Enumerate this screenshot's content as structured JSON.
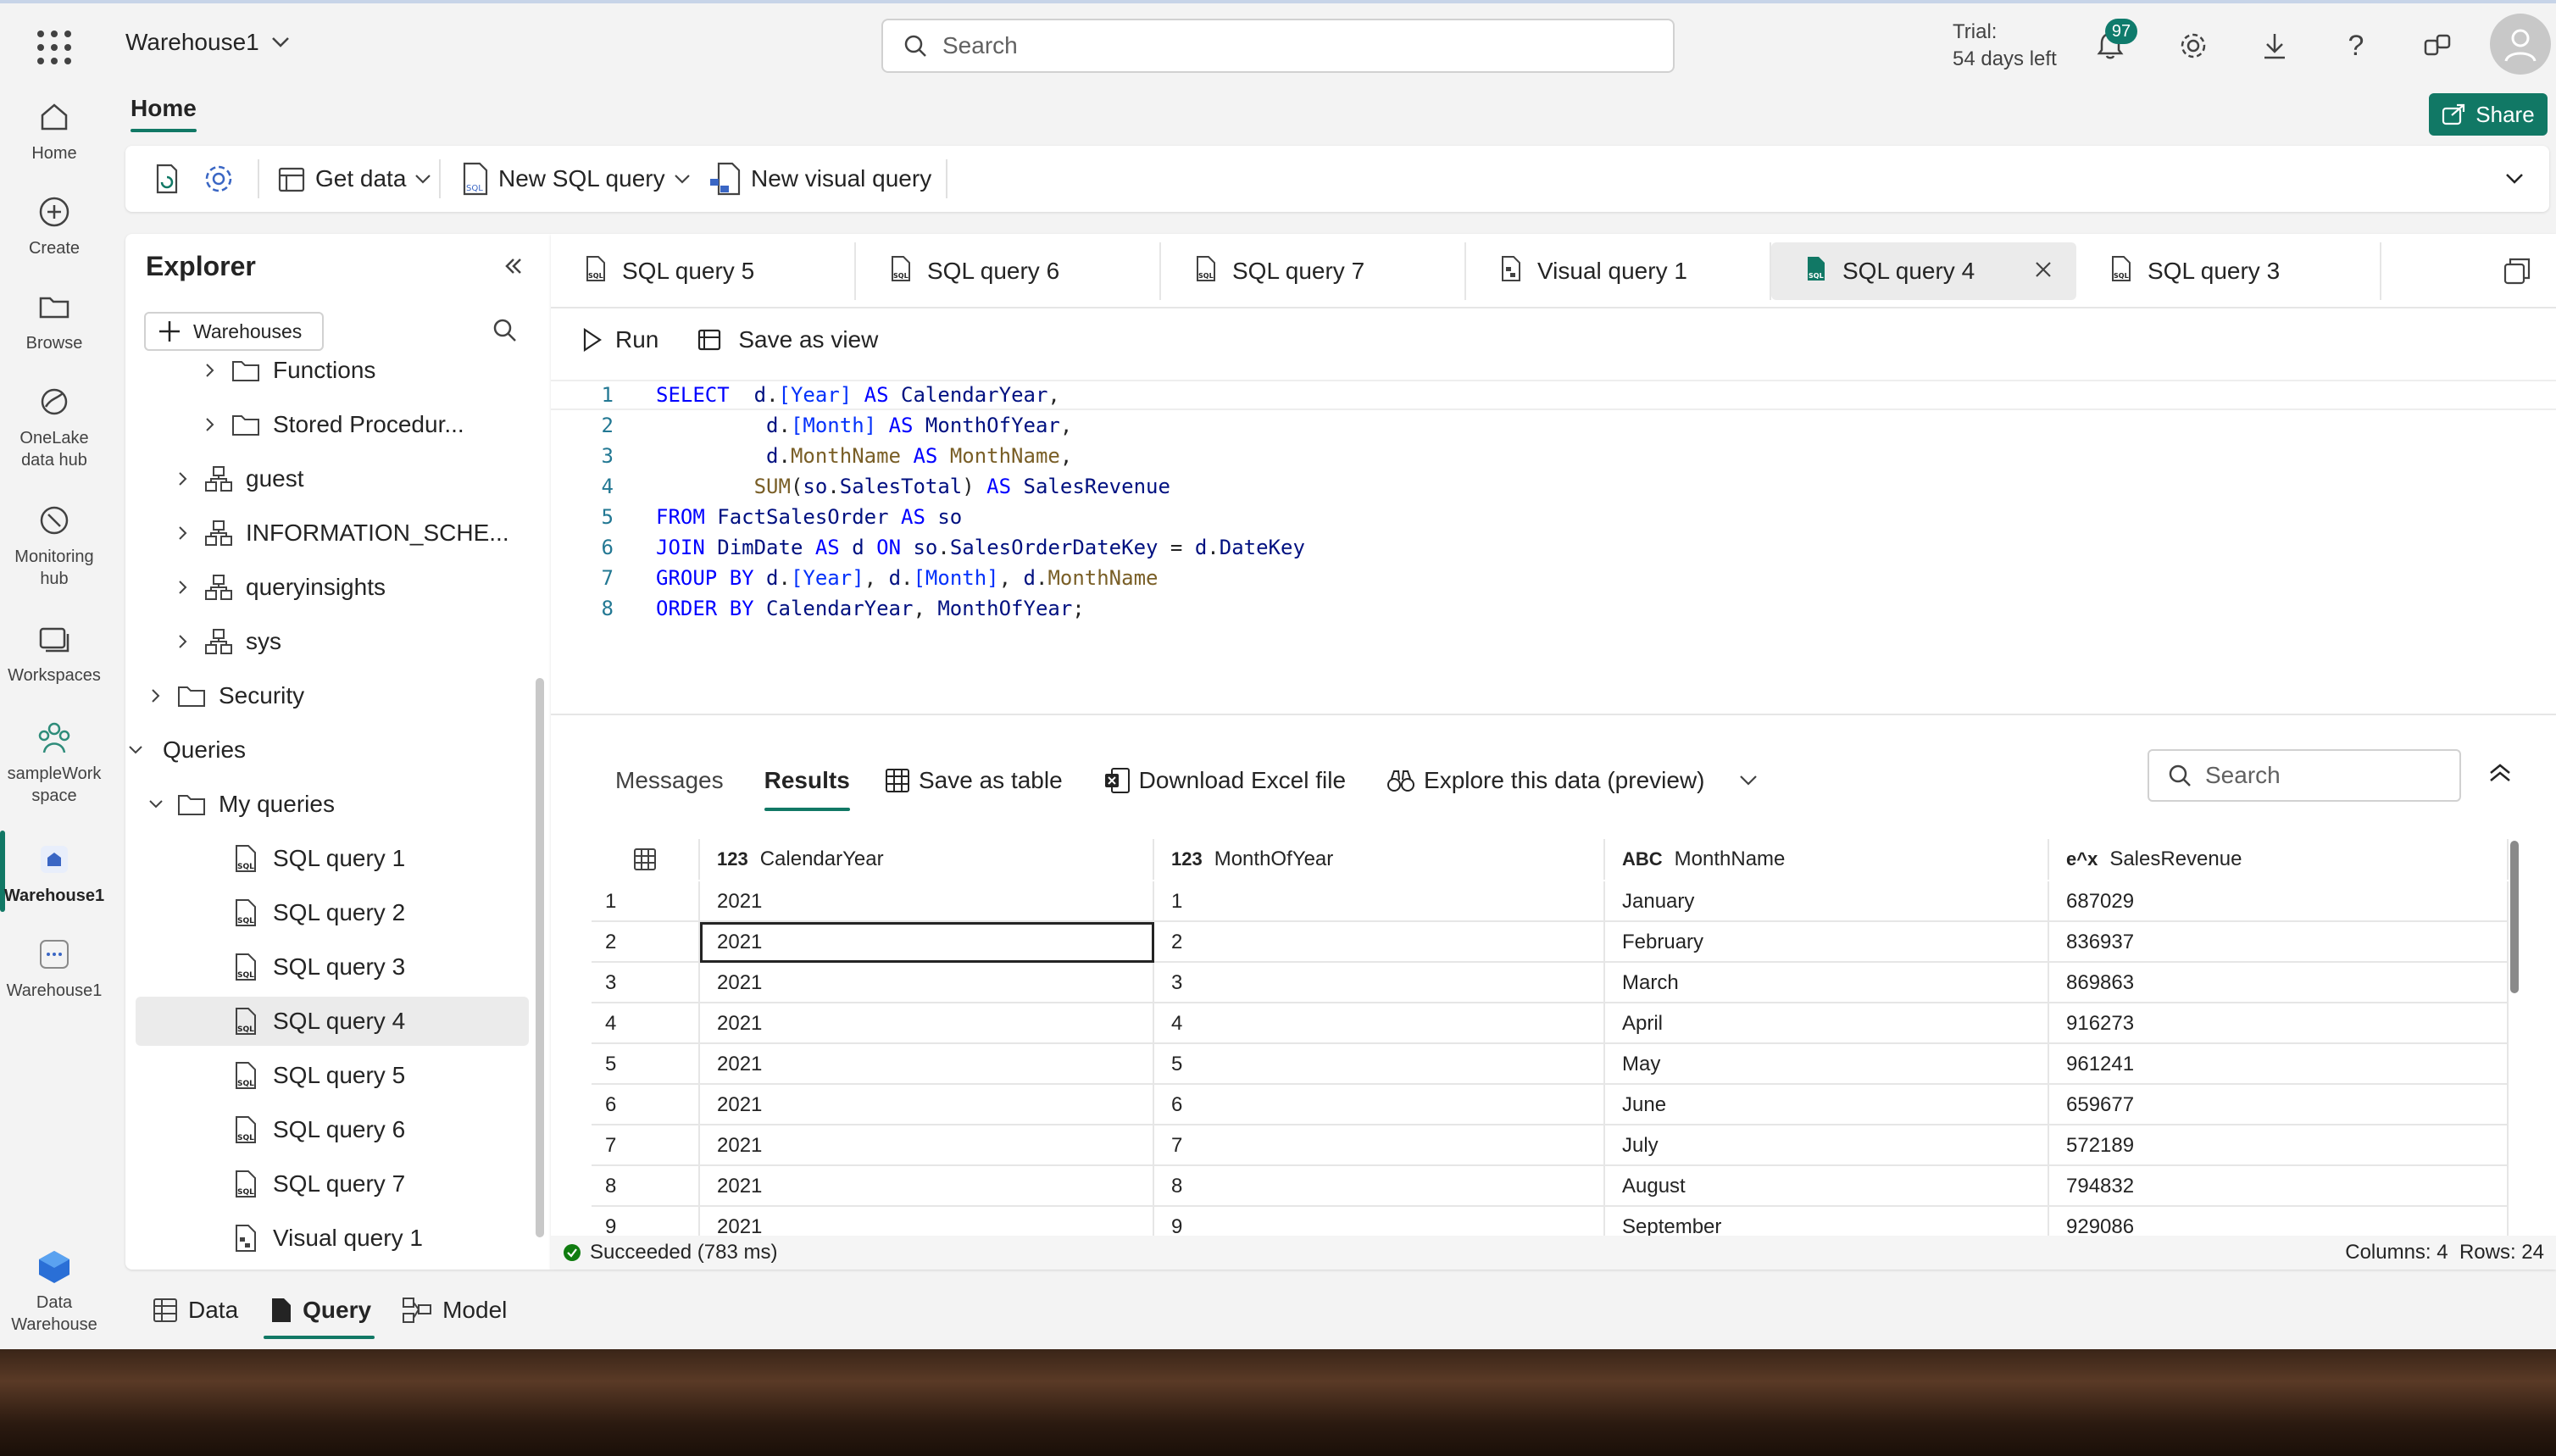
{
  "header": {
    "workspace": "Warehouse1",
    "search_placeholder": "Search",
    "trial_line1": "Trial:",
    "trial_line2": "54 days left",
    "notification_count": "97"
  },
  "rail": [
    {
      "label": "Home",
      "icon": "home-icon"
    },
    {
      "label": "Create",
      "icon": "create-icon"
    },
    {
      "label": "Browse",
      "icon": "folder-icon"
    },
    {
      "label": "OneLake data hub",
      "icon": "onelake-icon"
    },
    {
      "label": "Monitoring hub",
      "icon": "monitor-icon"
    },
    {
      "label": "Workspaces",
      "icon": "workspaces-icon"
    },
    {
      "label": "sampleWork space",
      "icon": "workspace-people-icon"
    },
    {
      "label": "Warehouse1",
      "icon": "warehouse-icon"
    },
    {
      "label": "Warehouse1",
      "icon": "warehouse-icon"
    },
    {
      "label": "Data Warehouse",
      "icon": "data-warehouse-icon"
    }
  ],
  "ribbon": {
    "tab": "Home",
    "share": "Share",
    "get_data": "Get data",
    "new_sql_query": "New SQL query",
    "new_visual_query": "New visual query"
  },
  "explorer": {
    "title": "Explorer",
    "warehouses_btn": "Warehouses",
    "tree": [
      "Functions",
      "Stored Procedur...",
      "guest",
      "INFORMATION_SCHE...",
      "queryinsights",
      "sys",
      "Security",
      "Queries",
      "My queries",
      "SQL query 1",
      "SQL query 2",
      "SQL query 3",
      "SQL query 4",
      "SQL query 5",
      "SQL query 6",
      "SQL query 7",
      "Visual query 1"
    ]
  },
  "tabs": [
    "SQL query 5",
    "SQL query 6",
    "SQL query 7",
    "Visual query 1",
    "SQL query 4",
    "SQL query 3"
  ],
  "editor": {
    "run": "Run",
    "save_as_view": "Save as view",
    "line_numbers": [
      "1",
      "2",
      "3",
      "4",
      "5",
      "6",
      "7",
      "8"
    ]
  },
  "results": {
    "tab_messages": "Messages",
    "tab_results": "Results",
    "save_as_table": "Save as table",
    "download_excel": "Download Excel file",
    "explore": "Explore this data (preview)",
    "search_placeholder": "Search",
    "columns": [
      {
        "type": "123",
        "name": "CalendarYear"
      },
      {
        "type": "123",
        "name": "MonthOfYear"
      },
      {
        "type": "ABC",
        "name": "MonthName"
      },
      {
        "type": "e^x",
        "name": "SalesRevenue"
      }
    ],
    "rows": [
      [
        "1",
        "2021",
        "1",
        "January",
        "687029"
      ],
      [
        "2",
        "2021",
        "2",
        "February",
        "836937"
      ],
      [
        "3",
        "2021",
        "3",
        "March",
        "869863"
      ],
      [
        "4",
        "2021",
        "4",
        "April",
        "916273"
      ],
      [
        "5",
        "2021",
        "5",
        "May",
        "961241"
      ],
      [
        "6",
        "2021",
        "6",
        "June",
        "659677"
      ],
      [
        "7",
        "2021",
        "7",
        "July",
        "572189"
      ],
      [
        "8",
        "2021",
        "8",
        "August",
        "794832"
      ],
      [
        "9",
        "2021",
        "9",
        "September",
        "929086"
      ]
    ],
    "status": "Succeeded (783 ms)",
    "summary": "Columns: 4  Rows: 24"
  },
  "bottom_tabs": [
    "Data",
    "Query",
    "Model"
  ]
}
